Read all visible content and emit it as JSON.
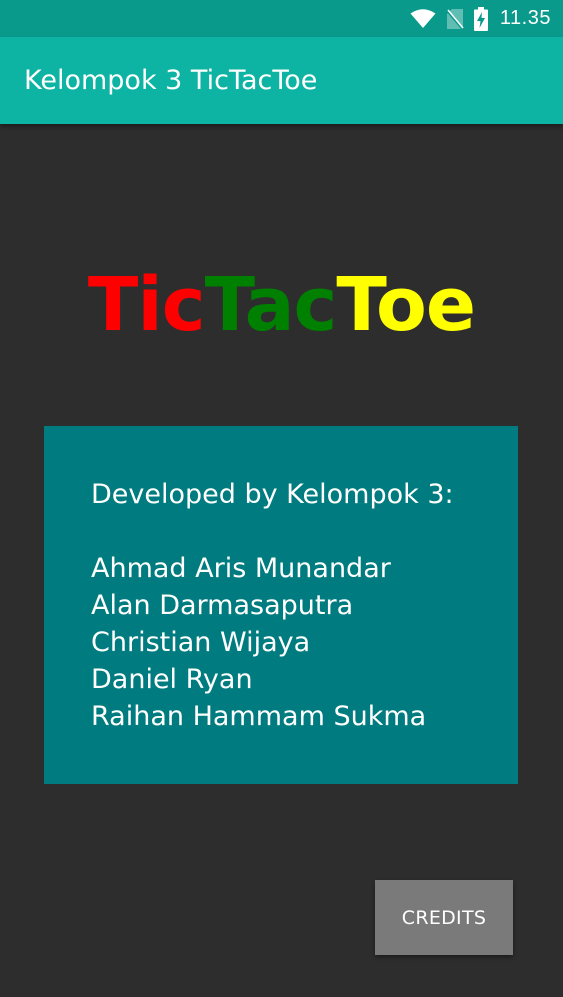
{
  "status_bar": {
    "time": "11.35",
    "icons": [
      "wifi-icon",
      "no-sim-icon",
      "battery-charging-icon"
    ]
  },
  "app_bar": {
    "title": "Kelompok 3 TicTacToe"
  },
  "logo": {
    "parts": [
      {
        "text": "Tic",
        "color": "#ff0000"
      },
      {
        "text": "Tac",
        "color": "#008000"
      },
      {
        "text": "Toe",
        "color": "#ffff00"
      }
    ]
  },
  "credits_card": {
    "heading": "Developed by Kelompok 3:",
    "members": [
      "Ahmad Aris Munandar",
      "Alan Darmasaputra",
      "Christian Wijaya",
      "Daniel Ryan",
      "Raihan Hammam Sukma"
    ]
  },
  "actions": {
    "credits_label": "CREDITS"
  },
  "colors": {
    "status_bar": "#0a9a8c",
    "app_bar": "#0db3a3",
    "background": "#2d2d2d",
    "card": "#007b7f",
    "button": "#7a7a7a"
  }
}
